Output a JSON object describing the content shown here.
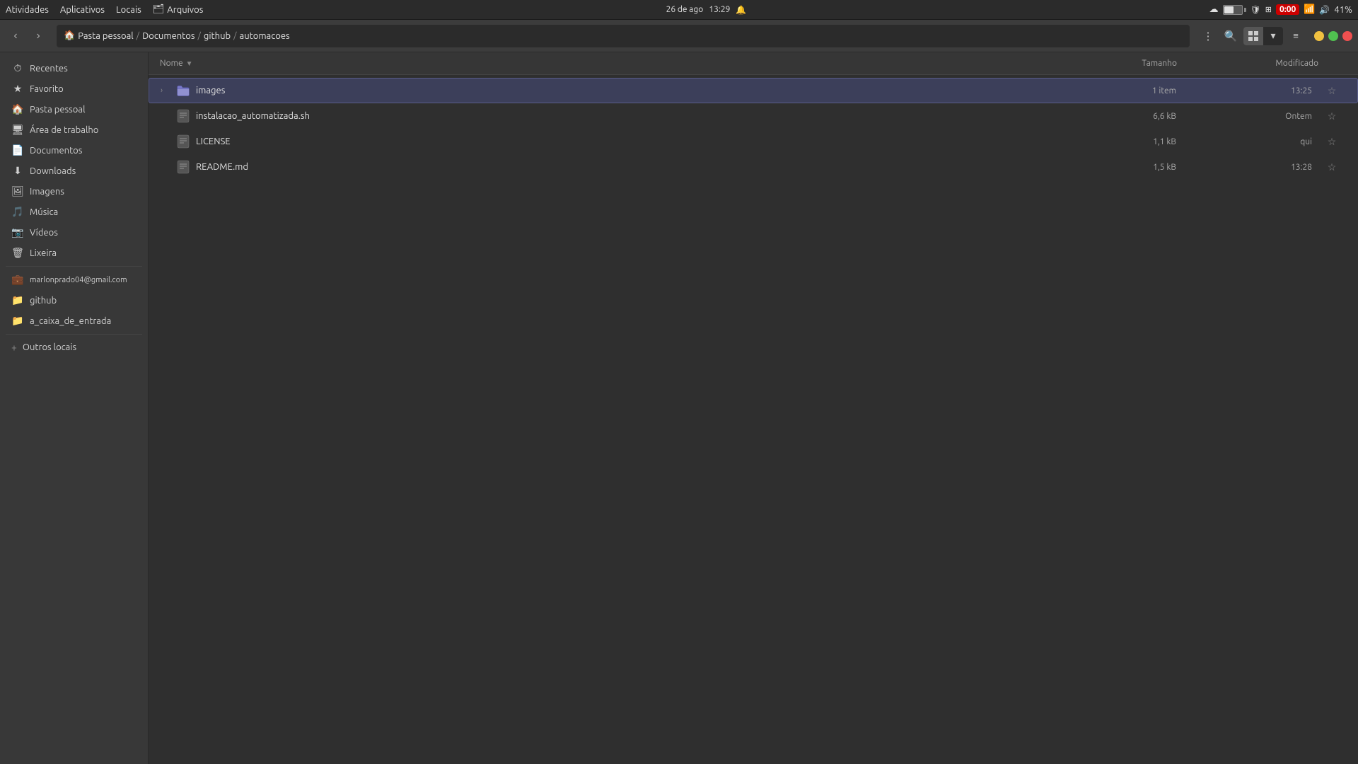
{
  "systemBar": {
    "left": {
      "activities": "Atividades",
      "applications": "Aplicativos",
      "locals": "Locais",
      "files": "Arquivos"
    },
    "center": {
      "date": "26 de ago",
      "time": "13:29"
    },
    "right": {
      "battery_percent": "41%",
      "timer": "0:00",
      "bell_icon": "🔔",
      "cloud_icon": "☁"
    }
  },
  "toolbar": {
    "back_label": "‹",
    "forward_label": "›",
    "breadcrumb": [
      {
        "label": "Pasta pessoal",
        "type": "home"
      },
      {
        "label": "Documentos",
        "type": "crumb"
      },
      {
        "label": "github",
        "type": "crumb"
      },
      {
        "label": "automacoes",
        "type": "current"
      }
    ],
    "menu_icon": "⋮",
    "search_icon": "🔍",
    "view_list_icon": "≡",
    "view_grid_icon": "⊞",
    "view_caret_icon": "▾",
    "minimize_icon": "─",
    "maximize_icon": "□",
    "close_icon": "✕"
  },
  "sidebar": {
    "items": [
      {
        "id": "recentes",
        "label": "Recentes",
        "icon": "★"
      },
      {
        "id": "favorito",
        "label": "Favorito",
        "icon": "★"
      },
      {
        "id": "pasta-pessoal",
        "label": "Pasta pessoal",
        "icon": "🏠"
      },
      {
        "id": "area-trabalho",
        "label": "Área de trabalho",
        "icon": "🖥"
      },
      {
        "id": "documentos",
        "label": "Documentos",
        "icon": "📄"
      },
      {
        "id": "downloads",
        "label": "Downloads",
        "icon": "⬇"
      },
      {
        "id": "imagens",
        "label": "Imagens",
        "icon": "🖼"
      },
      {
        "id": "musica",
        "label": "Música",
        "icon": "🎵"
      },
      {
        "id": "videos",
        "label": "Vídeos",
        "icon": "📷"
      },
      {
        "id": "lixeira",
        "label": "Lixeira",
        "icon": "🗑"
      }
    ],
    "network_items": [
      {
        "id": "email",
        "label": "marlonprado04@gmail.com",
        "icon": "💼"
      },
      {
        "id": "github",
        "label": "github",
        "icon": "📁"
      },
      {
        "id": "caixa",
        "label": "a_caixa_de_entrada",
        "icon": "📁"
      }
    ],
    "other_locations": "Outros locais"
  },
  "fileList": {
    "columns": {
      "name": "Nome",
      "size": "Tamanho",
      "modified": "Modificado"
    },
    "files": [
      {
        "id": "images",
        "name": "images",
        "type": "folder",
        "size": "1 item",
        "modified": "13:25",
        "starred": false,
        "selected": true,
        "has_arrow": true
      },
      {
        "id": "instalacao",
        "name": "instalacao_automatizada.sh",
        "type": "script",
        "size": "6,6 kB",
        "modified": "Ontem",
        "starred": false,
        "selected": false,
        "has_arrow": false
      },
      {
        "id": "license",
        "name": "LICENSE",
        "type": "file",
        "size": "1,1 kB",
        "modified": "qui",
        "starred": false,
        "selected": false,
        "has_arrow": false
      },
      {
        "id": "readme",
        "name": "README.md",
        "type": "markdown",
        "size": "1,5 kB",
        "modified": "13:28",
        "starred": false,
        "selected": false,
        "has_arrow": false
      }
    ]
  }
}
